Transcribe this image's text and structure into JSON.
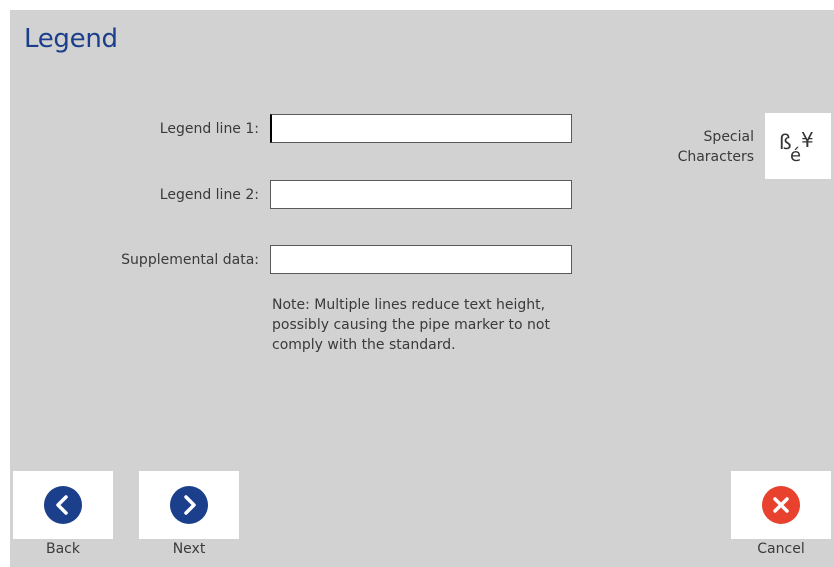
{
  "header": {
    "title": "Legend"
  },
  "form": {
    "legend_line_1": {
      "label": "Legend line 1:",
      "value": ""
    },
    "legend_line_2": {
      "label": "Legend line 2:",
      "value": ""
    },
    "supplemental": {
      "label": "Supplemental data:",
      "value": ""
    },
    "note": "Note: Multiple lines reduce text height, possibly causing the pipe marker to not comply with the standard."
  },
  "special_characters": {
    "label_line_1": "Special",
    "label_line_2": "Characters",
    "icon": "special-characters-icon",
    "icon_glyphs": "ßé¥"
  },
  "footer": {
    "back_label": "Back",
    "next_label": "Next",
    "cancel_label": "Cancel",
    "back_icon": "chevron-left-icon",
    "next_icon": "chevron-right-icon",
    "cancel_icon": "close-icon"
  },
  "colors": {
    "background": "#d2d2d2",
    "title": "#1b3f8b",
    "nav_circle": "#1b3f8b",
    "cancel_circle": "#e8412e"
  }
}
